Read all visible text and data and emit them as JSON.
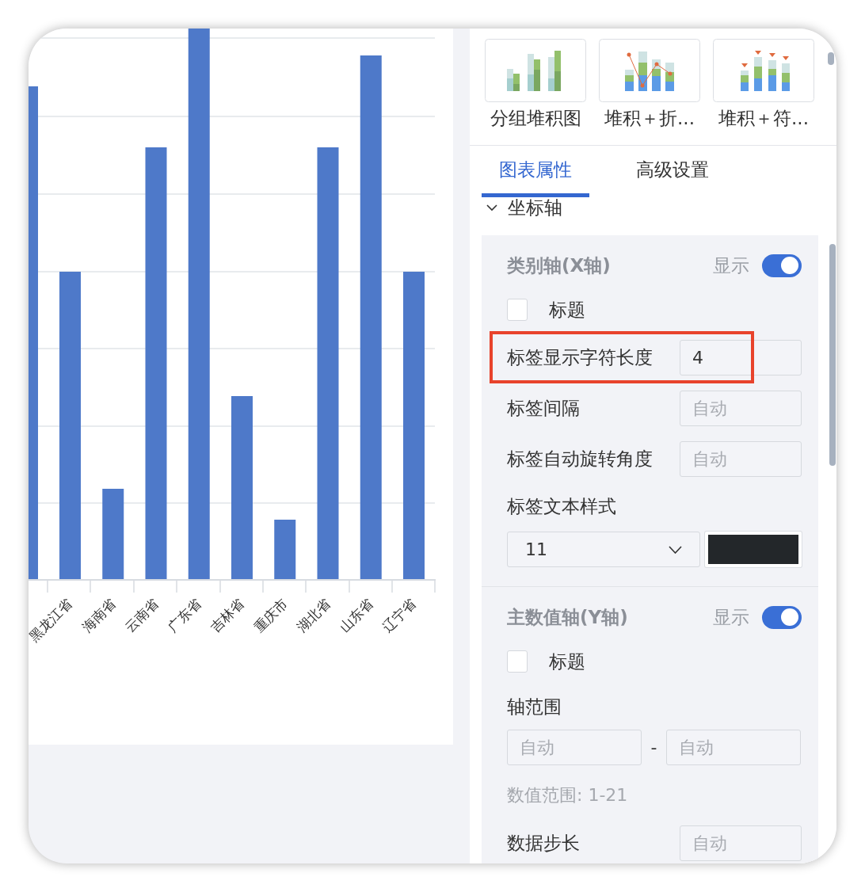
{
  "chart": {
    "x_labels": [
      "黑龙江省",
      "海南省",
      "云南省",
      "广东省",
      "吉林省",
      "重庆市",
      "湖北省",
      "山东省",
      "辽宁省"
    ]
  },
  "chart_types": [
    {
      "label": "分组堆积图",
      "kind": "grouped"
    },
    {
      "label": "堆积＋折...",
      "kind": "line"
    },
    {
      "label": "堆积＋符...",
      "kind": "marker"
    }
  ],
  "tabs": [
    {
      "label": "图表属性",
      "selected": true
    },
    {
      "label": "高级设置",
      "selected": false
    }
  ],
  "group": {
    "title": "坐标轴",
    "expanded": true
  },
  "sections": [
    {
      "title": "类别轴(X轴)",
      "toggle_label": "显示",
      "on": true,
      "title_checkbox": {
        "label": "标题",
        "checked": false
      },
      "items": [
        {
          "kind": "input",
          "label": "标签显示字符长度",
          "value": "4",
          "highlighted": true
        },
        {
          "kind": "input",
          "label": "标签间隔",
          "placeholder": "自动",
          "highlighted": false
        },
        {
          "kind": "input",
          "label": "标签自动旋转角度",
          "placeholder": "自动",
          "highlighted": false
        },
        {
          "kind": "text_style",
          "label": "标签文本样式",
          "size": "11",
          "color": "#23272a",
          "highlighted": false
        }
      ]
    },
    {
      "title": "主数值轴(Y轴)",
      "toggle_label": "显示",
      "on": true,
      "title_checkbox": {
        "label": "标题",
        "checked": false
      },
      "items": [
        {
          "kind": "range",
          "label": "轴范围",
          "min_placeholder": "自动",
          "separator": "-",
          "max_placeholder": "自动",
          "hint": "数值范围: 1-21",
          "highlighted": false
        },
        {
          "kind": "input",
          "label": "数据步长",
          "placeholder": "自动",
          "highlighted": false
        }
      ]
    }
  ]
}
